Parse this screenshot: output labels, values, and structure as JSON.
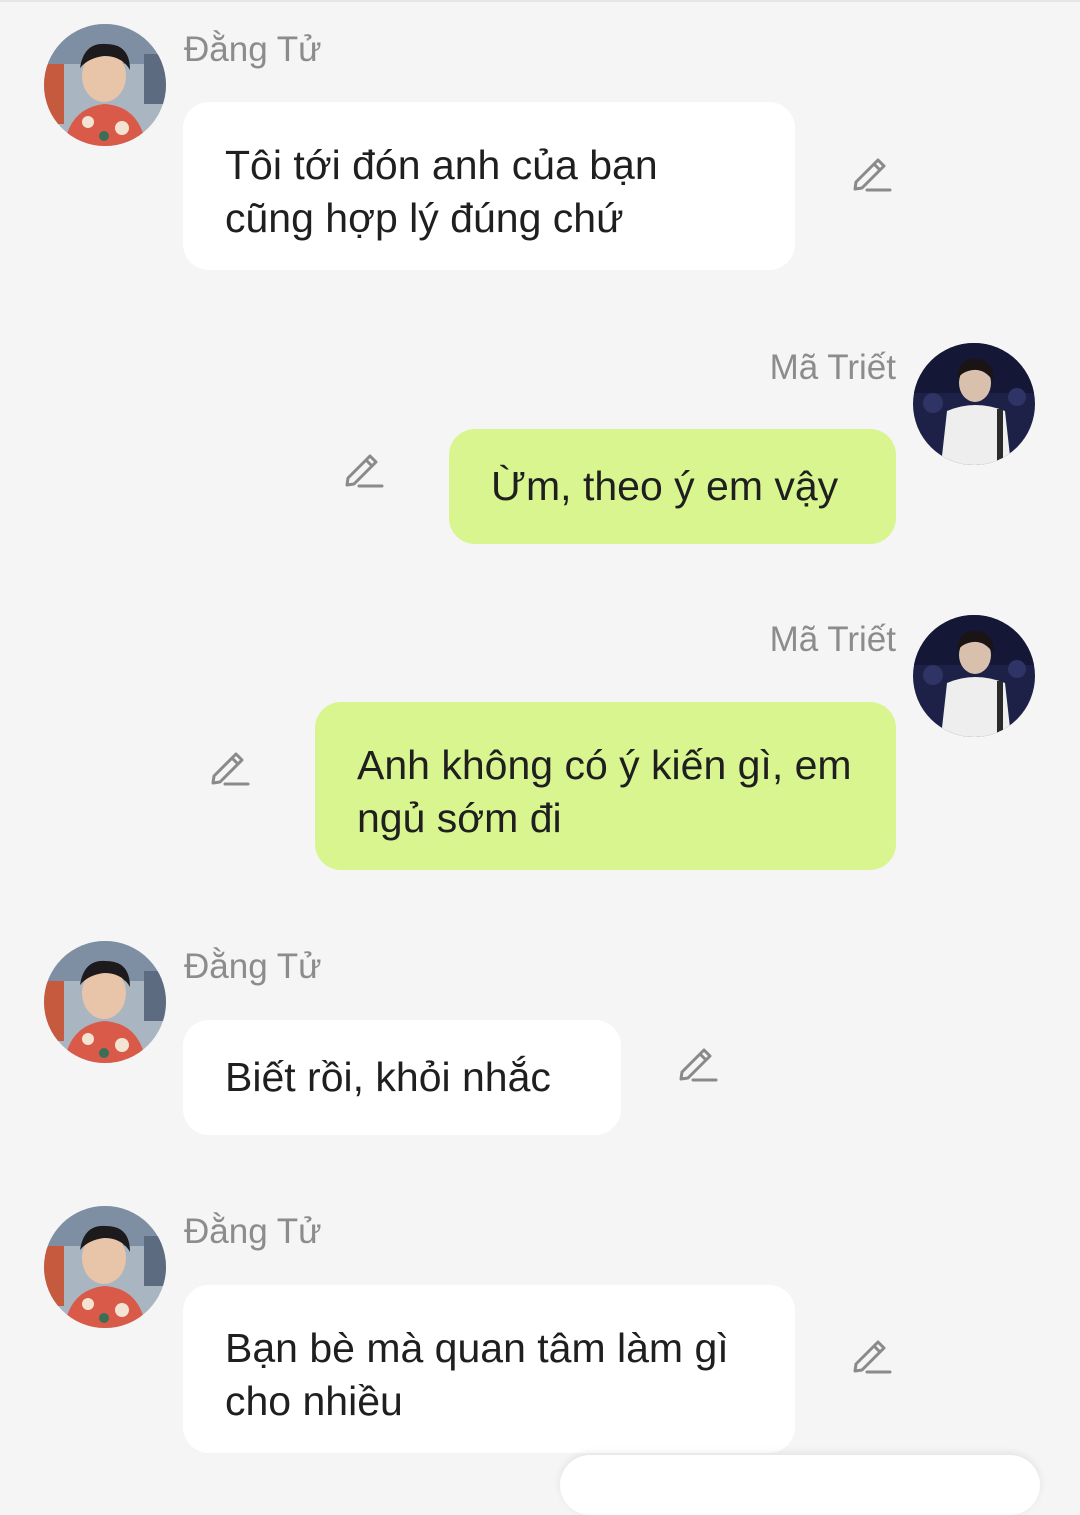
{
  "messages": [
    {
      "sender": "Đằng Tử",
      "side": "left",
      "text": "Tôi tới đón anh của bạn cũng hợp lý đúng chứ",
      "avatar_icon": "avatar-dang-tu"
    },
    {
      "sender": "Mã Triết",
      "side": "right",
      "text": "Ừm, theo ý em vậy",
      "avatar_icon": "avatar-ma-triet"
    },
    {
      "sender": "Mã Triết",
      "side": "right",
      "text": "Anh không có ý kiến gì, em ngủ sớm đi",
      "avatar_icon": "avatar-ma-triet"
    },
    {
      "sender": "Đằng Tử",
      "side": "left",
      "text": "Biết rồi, khỏi nhắc",
      "avatar_icon": "avatar-dang-tu"
    },
    {
      "sender": "Đằng Tử",
      "side": "left",
      "text": "Bạn bè mà quan tâm làm gì cho nhiều",
      "avatar_icon": "avatar-dang-tu"
    }
  ],
  "icons": {
    "edit": "pencil-edit-icon"
  },
  "colors": {
    "background": "#f5f5f5",
    "left_bubble": "#ffffff",
    "right_bubble": "#d8f590",
    "name_text": "#8c8c8c",
    "message_text": "#1f1f1f",
    "edit_icon": "#8a8a8a"
  }
}
